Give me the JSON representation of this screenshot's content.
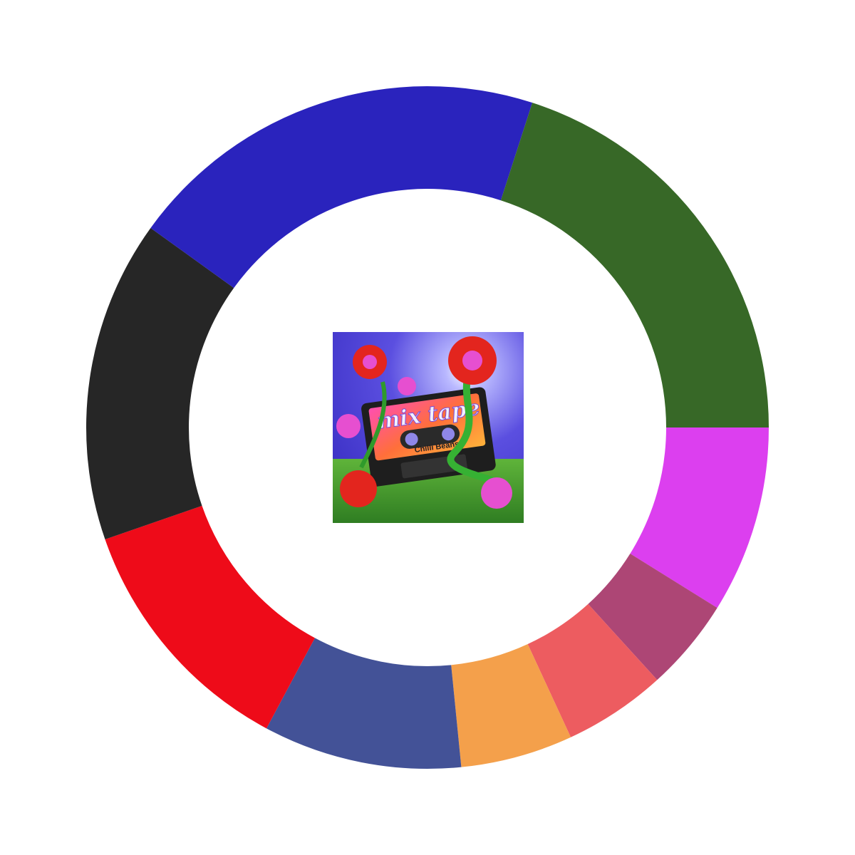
{
  "chart_data": {
    "type": "pie",
    "donut": true,
    "start": "right",
    "direction": "clockwise",
    "slices": [
      {
        "value": 11.5,
        "color": "#dc3fef"
      },
      {
        "value": 5.7,
        "color": "#ad4675"
      },
      {
        "value": 6.3,
        "color": "#ed5c60"
      },
      {
        "value": 6.9,
        "color": "#f4a04b"
      },
      {
        "value": 12.2,
        "color": "#435297"
      },
      {
        "value": 15.4,
        "color": "#ee0b19"
      },
      {
        "value": 19.8,
        "color": "#262626"
      },
      {
        "value": 26.0,
        "color": "#2a23bd"
      },
      {
        "value": 26.0,
        "color": "#376827"
      }
    ]
  },
  "center_art": {
    "title": "mix tape",
    "subtitle": "Chilli Beans",
    "icon": "cassette-with-flowers-album-art"
  }
}
